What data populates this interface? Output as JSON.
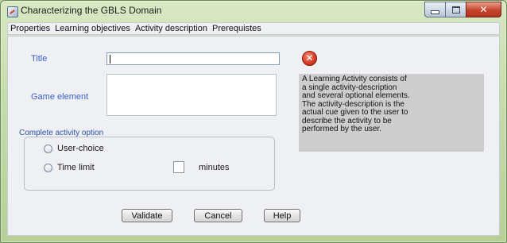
{
  "window": {
    "title": "Characterizing the GBLS Domain",
    "controls": {
      "minimize": "–",
      "maximize": "□",
      "close": "✕"
    }
  },
  "menu": [
    "Properties",
    "Learning objectives",
    "Activity description",
    "Prerequistes"
  ],
  "form": {
    "title_label": "Title",
    "title_value": "",
    "game_element_label": "Game element",
    "game_element_value": "",
    "error_icon_glyph": "✕"
  },
  "info_text": [
    "A Learning Activity consists of",
    "a single activity-description",
    "and several optional elements.",
    "The activity-description is the",
    "actual cue given to the user to",
    "describe the activity to be",
    "performed by the user."
  ],
  "options": {
    "group_title": "Complete activity option",
    "user_choice_label": "User-choice",
    "time_limit_label": "Time limit",
    "minutes_value": "",
    "minutes_label": "minutes"
  },
  "buttons": {
    "validate": "Validate",
    "cancel": "Cancel",
    "help": "Help"
  },
  "colors": {
    "label_blue": "#3a5fc9",
    "close_red": "#c6432c",
    "panel_gray": "#cdcdcd"
  }
}
